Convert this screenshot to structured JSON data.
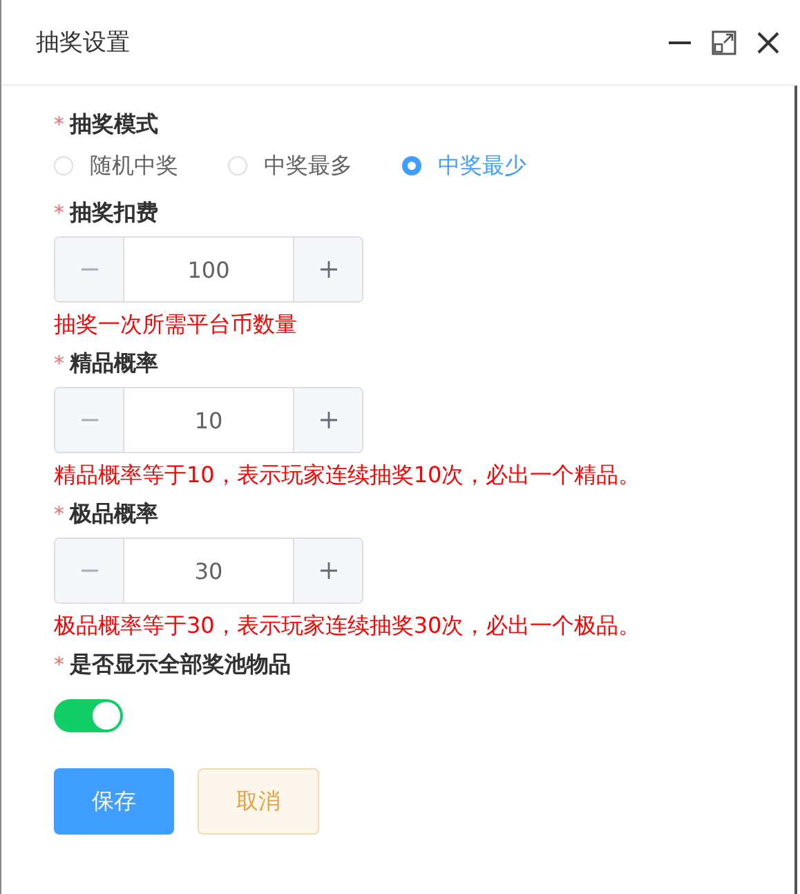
{
  "window": {
    "title": "抽奖设置"
  },
  "fields": [
    {
      "kind": "radio",
      "required_mark": "*",
      "label": "抽奖模式",
      "options": [
        {
          "label": "随机中奖",
          "selected": false
        },
        {
          "label": "中奖最多",
          "selected": false
        },
        {
          "label": "中奖最少",
          "selected": true
        }
      ]
    },
    {
      "kind": "stepper",
      "required_mark": "*",
      "label": "抽奖扣费",
      "value": "100",
      "hint": "抽奖一次所需平台币数量"
    },
    {
      "kind": "stepper",
      "required_mark": "*",
      "label": "精品概率",
      "value": "10",
      "hint": "精品概率等于10，表示玩家连续抽奖10次，必出一个精品。"
    },
    {
      "kind": "stepper",
      "required_mark": "*",
      "label": "极品概率",
      "value": "30",
      "hint": "极品概率等于30，表示玩家连续抽奖30次，必出一个极品。"
    },
    {
      "kind": "switch",
      "required_mark": "*",
      "label": "是否显示全部奖池物品",
      "on": true
    }
  ],
  "buttons": [
    {
      "kind": "primary",
      "label": "保存"
    },
    {
      "kind": "cancel",
      "label": "取消"
    }
  ]
}
